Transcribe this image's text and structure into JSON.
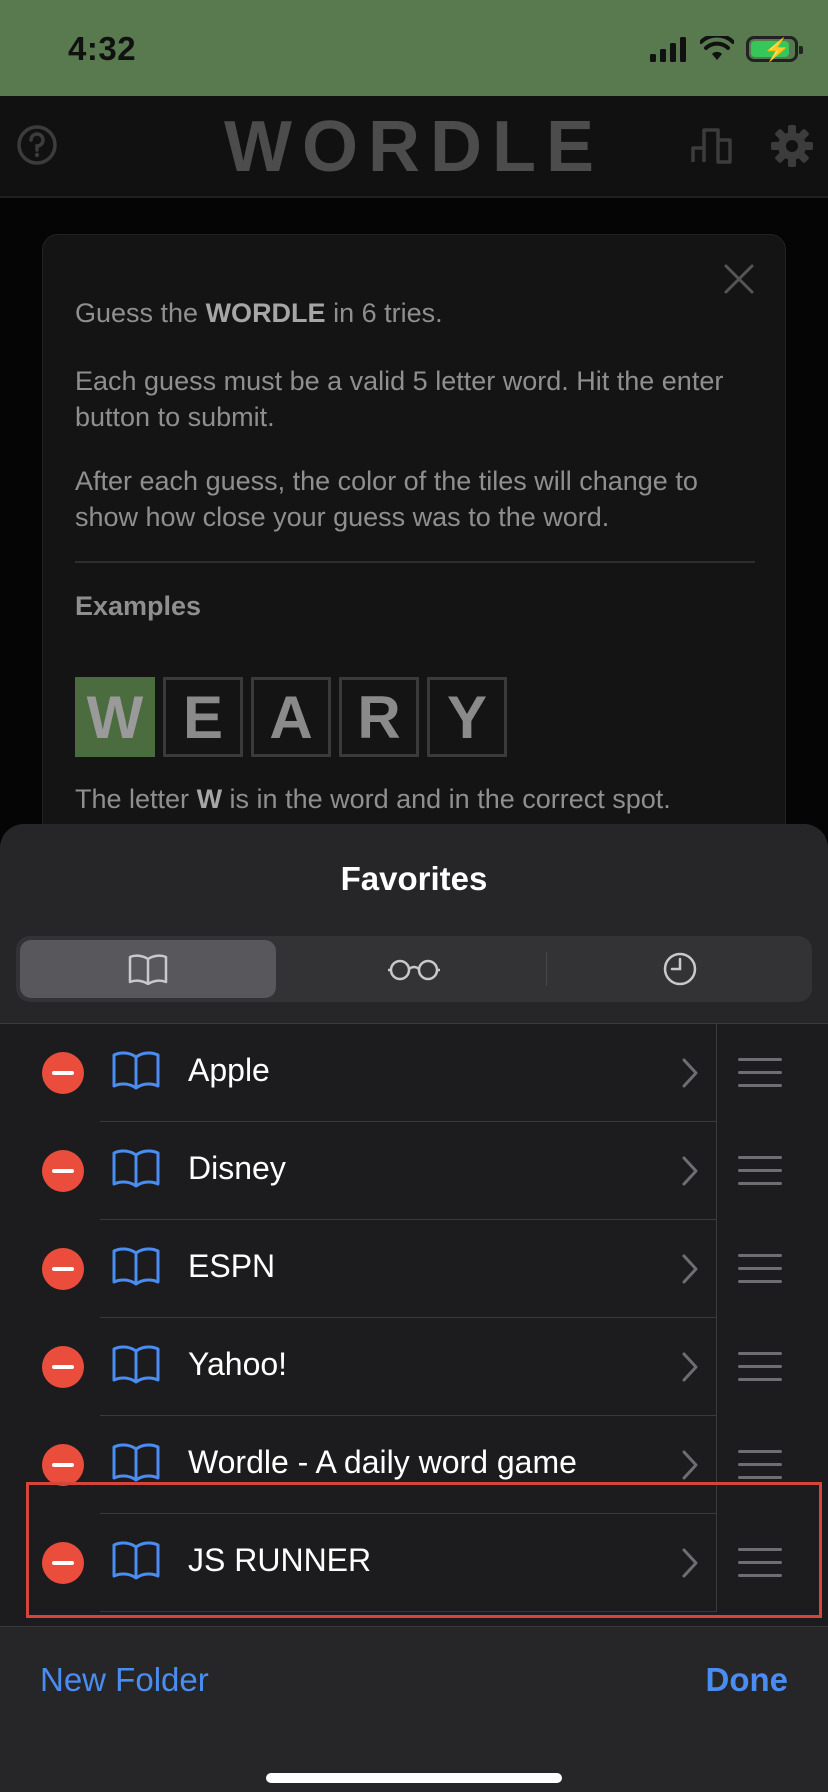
{
  "status_bar": {
    "time": "4:32",
    "signal_icon": "signal-bars-icon",
    "wifi_icon": "wifi-icon",
    "battery_icon": "battery-charging-icon",
    "bg_color": "#587a4e"
  },
  "wordle": {
    "title": "WORDLE",
    "help_icon": "question-circle-icon",
    "stats_icon": "bar-chart-icon",
    "settings_icon": "gear-icon",
    "modal": {
      "close_icon": "close-icon",
      "line1_pre": "Guess the ",
      "line1_bold": "WORDLE",
      "line1_post": " in 6 tries.",
      "line2": "Each guess must be a valid 5 letter word. Hit the enter button to submit.",
      "line3": "After each guess, the color of the tiles will change to show how close your guess was to the word.",
      "examples_title": "Examples",
      "example_tiles": [
        "W",
        "E",
        "A",
        "R",
        "Y"
      ],
      "explain_pre": "The letter ",
      "explain_bold": "W",
      "explain_post": " is in the word and in the correct spot."
    }
  },
  "sheet": {
    "title": "Favorites",
    "tabs": [
      {
        "icon": "book-icon",
        "active": true
      },
      {
        "icon": "glasses-icon",
        "active": false
      },
      {
        "icon": "clock-icon",
        "active": false
      }
    ],
    "items": [
      {
        "label": "Apple"
      },
      {
        "label": "Disney"
      },
      {
        "label": "ESPN"
      },
      {
        "label": "Yahoo!"
      },
      {
        "label": "Wordle - A daily word game"
      },
      {
        "label": "JS RUNNER"
      }
    ],
    "footer": {
      "new_folder": "New Folder",
      "done": "Done"
    },
    "accent_color": "#4a8df2",
    "delete_color": "#eb4d3d"
  }
}
